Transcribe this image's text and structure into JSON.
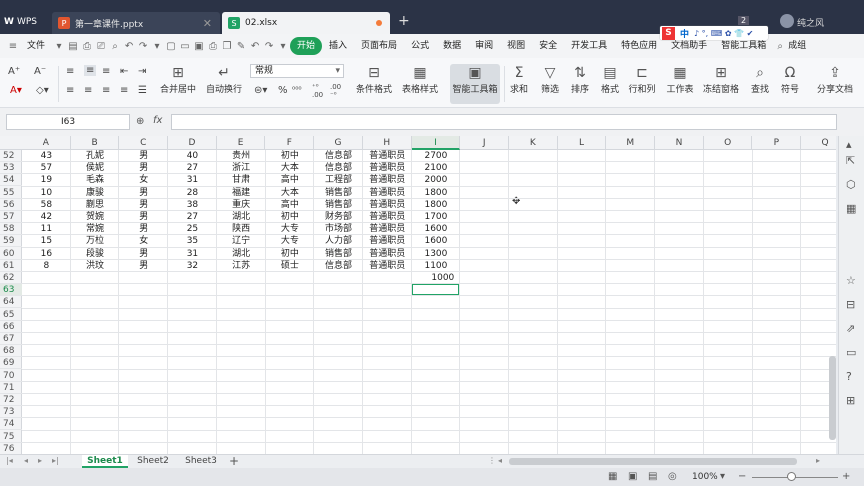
{
  "titlebar": {
    "app_label": "WPS",
    "tabs": [
      {
        "label": "第一章课件.pptx",
        "icon": "P"
      },
      {
        "label": "02.xlsx",
        "icon": "S"
      }
    ],
    "badge": "2",
    "user": "纯之风",
    "ime": {
      "logo": "S",
      "lang": "中",
      "icons": "♪ °, ⌨ ✿ 👕 ✔"
    }
  },
  "menu": {
    "file": "文件",
    "items": [
      "开始",
      "插入",
      "页面布局",
      "公式",
      "数据",
      "审阅",
      "视图",
      "安全",
      "开发工具",
      "特色应用",
      "文档助手",
      "智能工具箱"
    ],
    "active": "开始",
    "search": "成组"
  },
  "ribbon": {
    "merge": "合并居中",
    "wrap": "自动换行",
    "number_format": "常规",
    "percent": "%",
    "cond_format": "条件格式",
    "table_style": "表格样式",
    "smart_toolbox": "智能工具箱",
    "sum": "求和",
    "filter": "筛选",
    "sort": "排序",
    "format": "格式",
    "rowcol": "行和列",
    "sheet": "工作表",
    "freeze": "冻结窗格",
    "find": "查找",
    "symbol": "符号",
    "share": "分享文档"
  },
  "formula_bar": {
    "name_box": "I63",
    "fx": "fx",
    "value": ""
  },
  "grid": {
    "columns": [
      "A",
      "B",
      "C",
      "D",
      "E",
      "F",
      "G",
      "H",
      "I",
      "J",
      "K",
      "L",
      "M",
      "N",
      "O",
      "P",
      "Q"
    ],
    "selected_column": "I",
    "rows": [
      52,
      53,
      54,
      55,
      56,
      57,
      58,
      59,
      60,
      61,
      62,
      63,
      64,
      65,
      66,
      67,
      68,
      69,
      70,
      71,
      72,
      73,
      74,
      75,
      76
    ],
    "selected_row": 63,
    "active_cell": "I63",
    "data": [
      [
        "43",
        "孔妮",
        "男",
        "40",
        "贵州",
        "初中",
        "信息部",
        "普通职员",
        "2700"
      ],
      [
        "57",
        "侯妮",
        "男",
        "27",
        "浙江",
        "大本",
        "信息部",
        "普通职员",
        "2100"
      ],
      [
        "19",
        "毛森",
        "女",
        "31",
        "甘肃",
        "高中",
        "工程部",
        "普通职员",
        "2000"
      ],
      [
        "10",
        "康骏",
        "男",
        "28",
        "福建",
        "大本",
        "销售部",
        "普通职员",
        "1800"
      ],
      [
        "58",
        "蒯思",
        "男",
        "38",
        "重庆",
        "高中",
        "销售部",
        "普通职员",
        "1800"
      ],
      [
        "42",
        "贺婉",
        "男",
        "27",
        "湖北",
        "初中",
        "财务部",
        "普通职员",
        "1700"
      ],
      [
        "11",
        "常婉",
        "男",
        "25",
        "陕西",
        "大专",
        "市场部",
        "普通职员",
        "1600"
      ],
      [
        "15",
        "万柆",
        "女",
        "35",
        "辽宁",
        "大专",
        "人力部",
        "普通职员",
        "1600"
      ],
      [
        "16",
        "段骏",
        "男",
        "31",
        "湖北",
        "初中",
        "销售部",
        "普通职员",
        "1300"
      ],
      [
        "8",
        "洪玟",
        "男",
        "32",
        "江苏",
        "硕士",
        "信息部",
        "普通职员",
        "1100"
      ]
    ],
    "extra_cell": {
      "row": 62,
      "col": "I",
      "value": "1000"
    }
  },
  "sheets": {
    "tabs": [
      "Sheet1",
      "Sheet2",
      "Sheet3"
    ],
    "active": "Sheet1"
  },
  "status": {
    "zoom": "100%"
  },
  "colors": {
    "accent": "#21a366",
    "titlebar": "#2b3346",
    "menu_active": "#1fa058"
  }
}
